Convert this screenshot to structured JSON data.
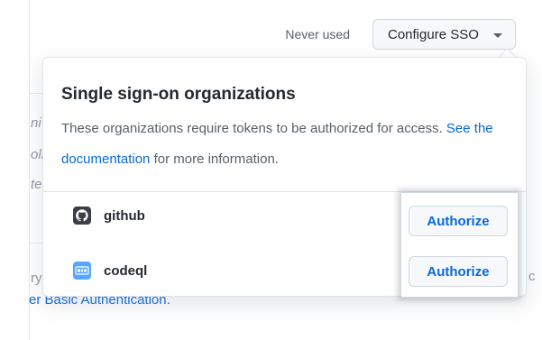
{
  "header": {
    "last_used": "Never used",
    "configure_sso_label": "Configure SSO"
  },
  "popover": {
    "title": "Single sign-on organizations",
    "desc_before": "These organizations require tokens to be authorized for access. ",
    "desc_link": "See the documentation",
    "desc_after": " for more information.",
    "organizations": [
      {
        "name": "github",
        "icon": "github-octocat-icon",
        "action": "Authorize"
      },
      {
        "name": "codeql",
        "icon": "codeql-icon",
        "action": "Authorize"
      }
    ]
  },
  "background": {
    "fragments": [
      "ni",
      "oli",
      "te",
      "ry",
      "c"
    ],
    "link_fragment": "er Basic Authentication."
  },
  "colors": {
    "link": "#0969da",
    "github_icon": "#3b3f45",
    "codeql_icon": "#58a6ff"
  }
}
